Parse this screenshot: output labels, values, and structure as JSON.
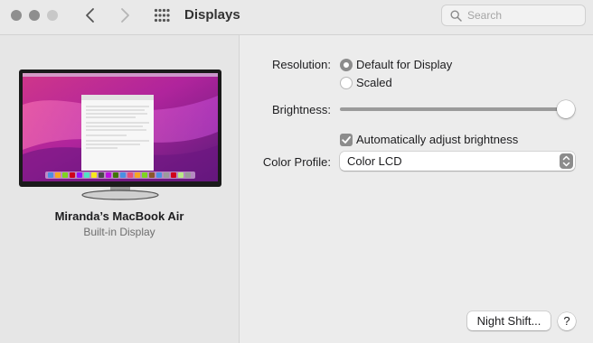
{
  "window": {
    "title": "Displays",
    "search_placeholder": "Search",
    "traffic_lights": [
      "close-icon",
      "minimize-icon",
      "zoom-icon"
    ],
    "nav": {
      "back_icon": "chevron-left-icon",
      "forward_icon": "chevron-right-icon",
      "grid_icon": "grid-icon"
    }
  },
  "sidebar": {
    "device_name": "Miranda’s MacBook Air",
    "device_subtitle": "Built-in Display"
  },
  "settings": {
    "resolution_label": "Resolution:",
    "resolution_options": [
      {
        "label": "Default for Display",
        "selected": true
      },
      {
        "label": "Scaled",
        "selected": false
      }
    ],
    "brightness_label": "Brightness:",
    "brightness_value": 1.0,
    "auto_brightness_label": "Automatically adjust brightness",
    "auto_brightness_checked": true,
    "color_profile_label": "Color Profile:",
    "color_profile_value": "Color LCD"
  },
  "footer": {
    "night_shift_label": "Night Shift...",
    "help_label": "?"
  },
  "colors": {
    "window_bg": "#ececec",
    "control_accent": "#8c8c8c",
    "wallpaper_magenta": "#b0249c"
  }
}
